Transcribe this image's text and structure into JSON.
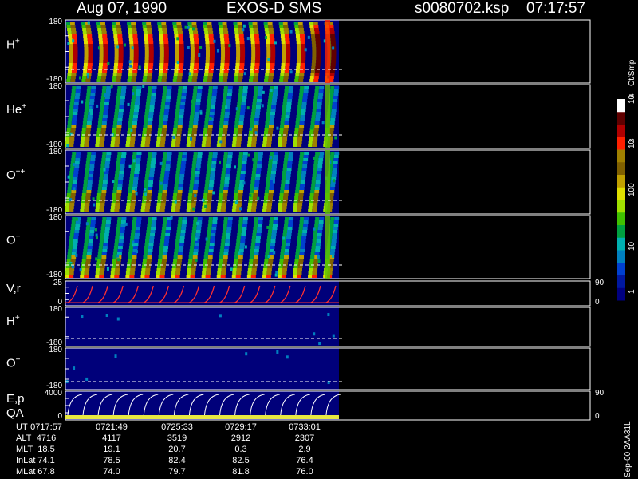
{
  "header": {
    "date": "Aug 07, 1990",
    "mission": "EXOS-D SMS",
    "file": "s0080702.ksp",
    "time": "07:17:57"
  },
  "colorbar": {
    "unit": "Ct/Smp",
    "tick_labels": [
      "1",
      "10",
      "100",
      "10",
      "3",
      "10",
      "4"
    ],
    "colors": [
      "#000080",
      "#0018a0",
      "#0040d0",
      "#0080c0",
      "#00b0b0",
      "#00a040",
      "#40c000",
      "#a0e000",
      "#e0e000",
      "#c0a000",
      "#806000",
      "#a08000",
      "#ff2000",
      "#b00000",
      "#600000",
      "#ffffff"
    ]
  },
  "panels": [
    {
      "label": "H",
      "sup": "+",
      "ytop": "180",
      "ybot": "-180"
    },
    {
      "label": "He",
      "sup": "+",
      "ytop": "180",
      "ybot": "-180"
    },
    {
      "label": "O",
      "sup": "++",
      "ytop": "180",
      "ybot": "-180"
    },
    {
      "label": "O",
      "sup": "+",
      "ytop": "180",
      "ybot": "-180"
    },
    {
      "label": "V,r",
      "sup": "",
      "ytop": "25",
      "ybot": "0",
      "rtop": "90",
      "rbot": "0"
    },
    {
      "label": "H",
      "sup": "+",
      "ytop": "180",
      "ybot": "-180"
    },
    {
      "label": "O",
      "sup": "+",
      "ytop": "180",
      "ybot": "-180"
    },
    {
      "label": "E,p",
      "label2": "QA",
      "sup": "",
      "ytop": "4000",
      "ybot": "0",
      "rtop": "90",
      "rbot": "0"
    }
  ],
  "side_label": "Sep-00  2AA31L",
  "ephemeris": {
    "rows": [
      {
        "name": "UT",
        "values": [
          "0717:57",
          "0721:49",
          "0725:33",
          "0729:17",
          "0733:01"
        ]
      },
      {
        "name": "ALT",
        "values": [
          "4716",
          "4117",
          "3519",
          "2912",
          "2307"
        ]
      },
      {
        "name": "MLT",
        "values": [
          "18.5",
          "19.1",
          "20.7",
          "0.3",
          "2.9"
        ]
      },
      {
        "name": "InLat",
        "values": [
          "74.1",
          "78.5",
          "82.4",
          "82.5",
          "76.4"
        ]
      },
      {
        "name": "MLat",
        "values": [
          "67.8",
          "74.0",
          "79.7",
          "81.8",
          "76.0"
        ]
      }
    ]
  },
  "chart_data": {
    "type": "heatmap",
    "title": "Aug 07, 1990   EXOS-D SMS",
    "x": [
      "0717:57",
      "0721:49",
      "0725:33",
      "0729:17",
      "0733:01"
    ],
    "xlabel": "UT",
    "ylabel": "",
    "ylim": [
      -180,
      180
    ],
    "colorscale": "log",
    "crange": [
      1,
      10000
    ],
    "spin_bands": 18,
    "series": [
      {
        "name": "H+",
        "ylim": [
          -180,
          180
        ]
      },
      {
        "name": "He+",
        "ylim": [
          -180,
          180
        ]
      },
      {
        "name": "O++",
        "ylim": [
          -180,
          180
        ]
      },
      {
        "name": "O+",
        "ylim": [
          -180,
          180
        ]
      },
      {
        "name": "V,r",
        "ylim": [
          0,
          25
        ]
      },
      {
        "name": "H+",
        "ylim": [
          -180,
          180
        ]
      },
      {
        "name": "O+",
        "ylim": [
          -180,
          180
        ]
      },
      {
        "name": "E,p",
        "ylim": [
          0,
          4000
        ]
      }
    ]
  }
}
